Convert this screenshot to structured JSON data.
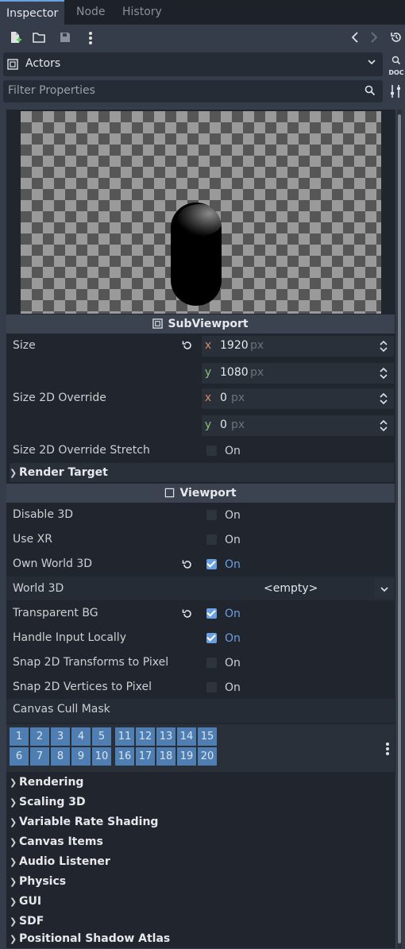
{
  "tabs": [
    {
      "label": "Inspector",
      "active": true
    },
    {
      "label": "Node",
      "active": false
    },
    {
      "label": "History",
      "active": false
    }
  ],
  "toolbar": {
    "icons": [
      "new-resource-icon",
      "open-icon",
      "save-icon",
      "more-icon",
      "back-icon",
      "forward-icon",
      "history-icon"
    ]
  },
  "object_selector": {
    "value": "Actors",
    "icon": "subviewport-icon"
  },
  "doc_button": {
    "label": "DOC"
  },
  "filter": {
    "placeholder": "Filter Properties"
  },
  "preview": {
    "node_type": "SubViewport"
  },
  "sections": {
    "subviewport": "SubViewport",
    "viewport": "Viewport"
  },
  "properties": {
    "size": {
      "label": "Size",
      "x": "1920",
      "y": "1080",
      "unit": "px",
      "x_axis": "x",
      "y_axis": "y"
    },
    "size_2d_override": {
      "label": "Size 2D Override",
      "x": "0",
      "y": "0",
      "unit": "px",
      "x_axis": "x",
      "y_axis": "y"
    },
    "size_2d_override_stretch": {
      "label": "Size 2D Override Stretch",
      "value": "On",
      "checked": false
    },
    "render_target": {
      "label": "Render Target"
    },
    "disable_3d": {
      "label": "Disable 3D",
      "value": "On",
      "checked": false
    },
    "use_xr": {
      "label": "Use XR",
      "value": "On",
      "checked": false
    },
    "own_world_3d": {
      "label": "Own World 3D",
      "value": "On",
      "checked": true
    },
    "world_3d": {
      "label": "World 3D",
      "value": "<empty>"
    },
    "transparent_bg": {
      "label": "Transparent BG",
      "value": "On",
      "checked": true
    },
    "handle_input_locally": {
      "label": "Handle Input Locally",
      "value": "On",
      "checked": true
    },
    "snap_2d_transforms": {
      "label": "Snap 2D Transforms to Pixel",
      "value": "On",
      "checked": false
    },
    "snap_2d_vertices": {
      "label": "Snap 2D Vertices to Pixel",
      "value": "On",
      "checked": false
    },
    "canvas_cull_mask": {
      "label": "Canvas Cull Mask",
      "layers_row1": [
        "1",
        "2",
        "3",
        "4",
        "5",
        "11",
        "12",
        "13",
        "14",
        "15"
      ],
      "layers_row2": [
        "6",
        "7",
        "8",
        "9",
        "10",
        "16",
        "17",
        "18",
        "19",
        "20"
      ]
    }
  },
  "categories": [
    "Rendering",
    "Scaling 3D",
    "Variable Rate Shading",
    "Canvas Items",
    "Audio Listener",
    "Physics",
    "GUI",
    "SDF",
    "Positional Shadow Atlas"
  ],
  "colors": {
    "accent": "#6aa0e0",
    "layer_active": "#4f7eb3",
    "x_axis": "#d08a6a",
    "y_axis": "#8ac07a"
  }
}
